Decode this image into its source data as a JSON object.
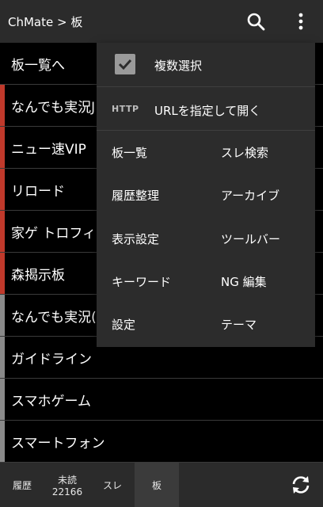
{
  "app": {
    "title": "ChMate > 板"
  },
  "list": {
    "items": [
      {
        "label": "板一覧へ",
        "accent": "#000000"
      },
      {
        "label": "なんでも実況J",
        "accent": "#c0392b"
      },
      {
        "label": "ニュー速VIP",
        "accent": "#c0392b"
      },
      {
        "label": "リロード",
        "accent": "#c0392b"
      },
      {
        "label": "家ゲ トロフィー",
        "accent": "#c0392b"
      },
      {
        "label": "森揭示板",
        "accent": "#c0392b"
      },
      {
        "label": "なんでも実況(ｼ",
        "accent": "#8a8a8a"
      },
      {
        "label": "ガイドライン",
        "accent": "#8a8a8a"
      },
      {
        "label": "スマホゲーム",
        "accent": "#8a8a8a"
      },
      {
        "label": "スマートフォン",
        "accent": "#8a8a8a"
      }
    ]
  },
  "menu": {
    "multi_select": "複数選択",
    "http_badge": "HTTP",
    "open_url": "URLを指定して開く",
    "grid": [
      [
        "板一覧",
        "スレ検索"
      ],
      [
        "履歴整理",
        "アーカイブ"
      ],
      [
        "表示設定",
        "ツールバー"
      ],
      [
        "キーワード",
        "NG 編集"
      ],
      [
        "設定",
        "テーマ"
      ]
    ]
  },
  "bottom": {
    "tabs": [
      "履歴",
      "未読",
      "スレ",
      "板"
    ],
    "unread_count": "22166"
  },
  "icons": {
    "search": "search-icon",
    "more": "more-vert-icon",
    "refresh": "refresh-icon",
    "check": "check-icon"
  }
}
